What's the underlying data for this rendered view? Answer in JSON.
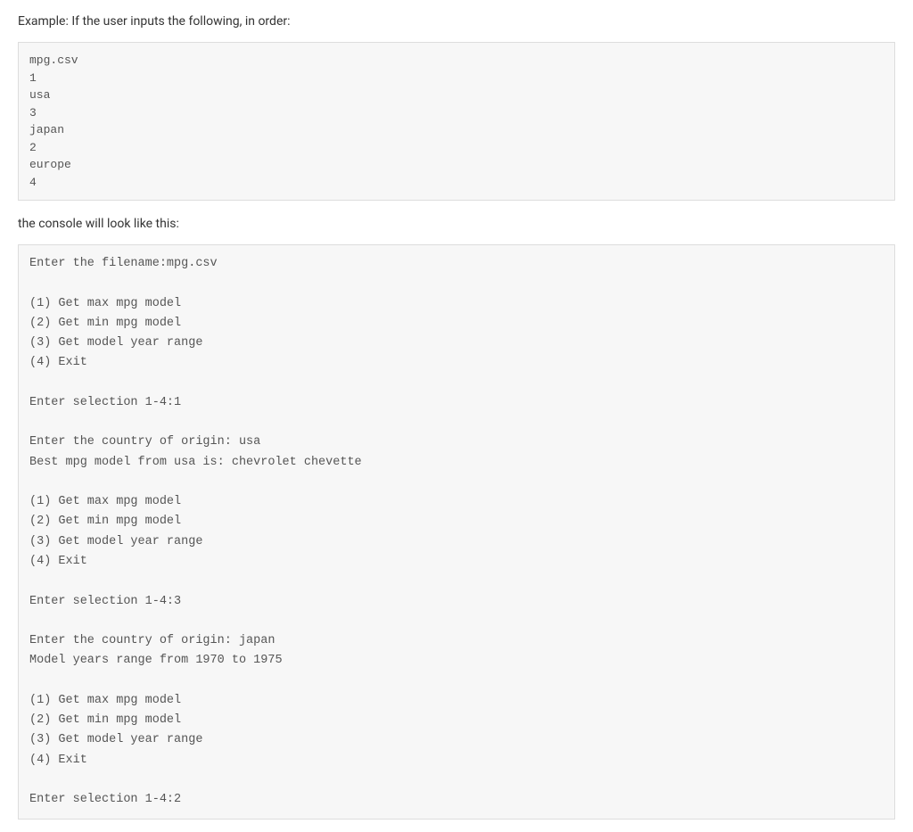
{
  "intro": "Example: If the user inputs the following, in order:",
  "input_block": "mpg.csv\n1\nusa\n3\njapan\n2\neurope\n4",
  "mid": "the console will look like this:",
  "console_block": "Enter the filename:mpg.csv\n\n(1) Get max mpg model\n(2) Get min mpg model\n(3) Get model year range\n(4) Exit\n\nEnter selection 1-4:1\n\nEnter the country of origin: usa\nBest mpg model from usa is: chevrolet chevette\n\n(1) Get max mpg model\n(2) Get min mpg model\n(3) Get model year range\n(4) Exit\n\nEnter selection 1-4:3\n\nEnter the country of origin: japan\nModel years range from 1970 to 1975\n\n(1) Get max mpg model\n(2) Get min mpg model\n(3) Get model year range\n(4) Exit\n\nEnter selection 1-4:2"
}
